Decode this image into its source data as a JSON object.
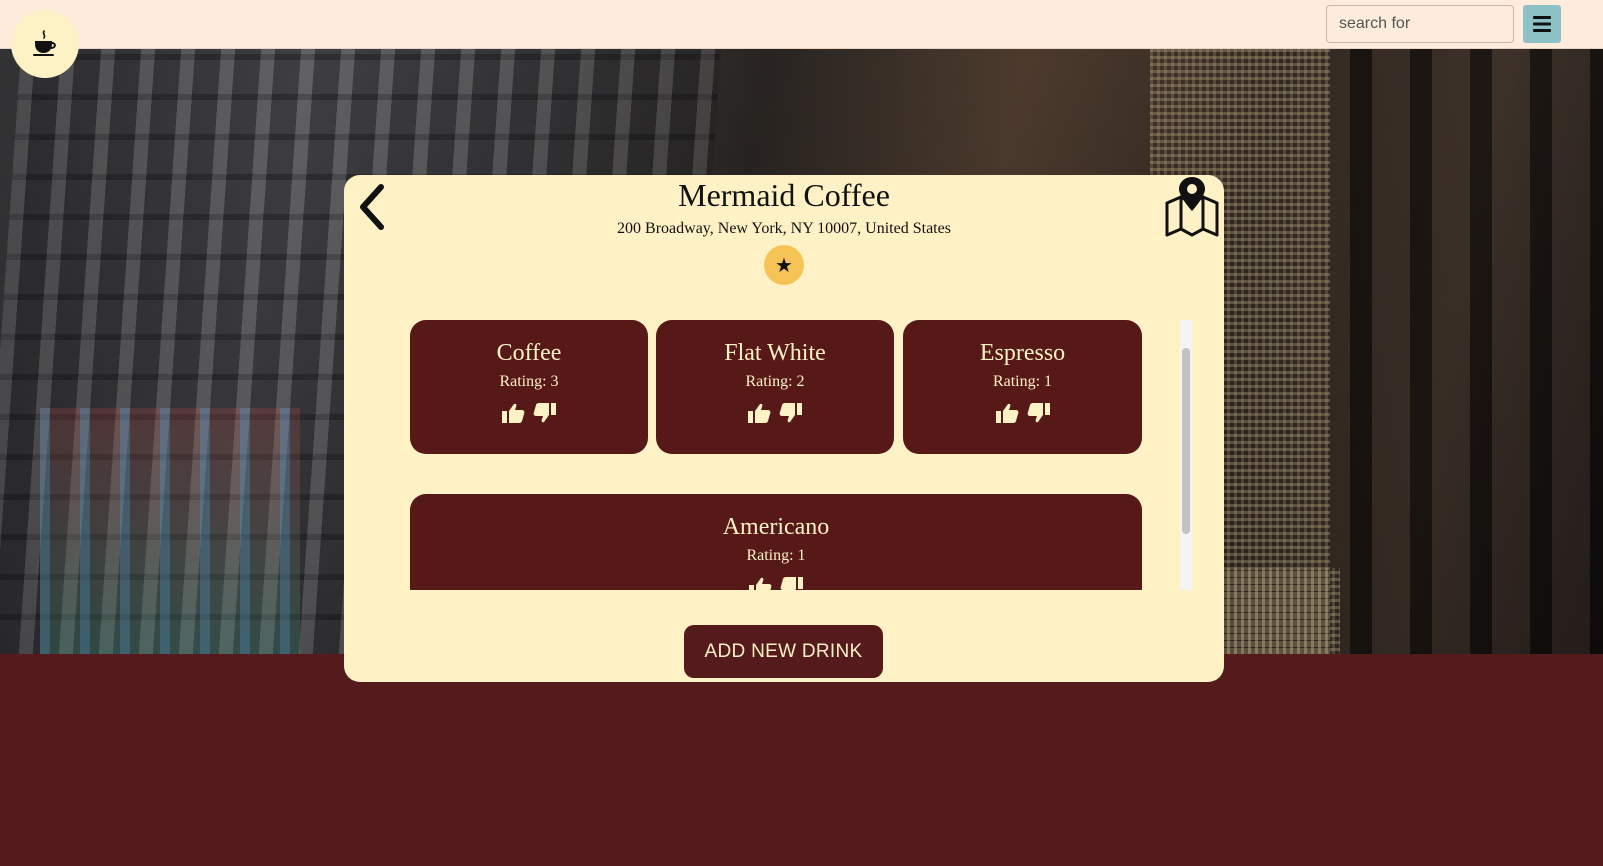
{
  "header": {
    "logo_icon": "coffee-cup-icon",
    "search": {
      "placeholder": "search for",
      "value": ""
    },
    "menu_icon": "hamburger-menu-icon"
  },
  "shop": {
    "name": "Mermaid Coffee",
    "address": "200 Broadway, New York, NY 10007, United States",
    "favorite_icon": "star-icon"
  },
  "drinks": [
    {
      "name": "Coffee",
      "rating_text": "Rating: 3"
    },
    {
      "name": "Flat White",
      "rating_text": "Rating: 2"
    },
    {
      "name": "Espresso",
      "rating_text": "Rating: 1"
    },
    {
      "name": "Americano",
      "rating_text": "Rating: 1"
    }
  ],
  "actions": {
    "add_drink_label": "ADD NEW DRINK"
  },
  "colors": {
    "header_bg": "#fdebdc",
    "panel_bg": "#fef1c5",
    "card_bg": "#571818",
    "page_bg": "#551a1b",
    "accent_star": "#f6c456",
    "menu_button": "#8cc1c6"
  }
}
